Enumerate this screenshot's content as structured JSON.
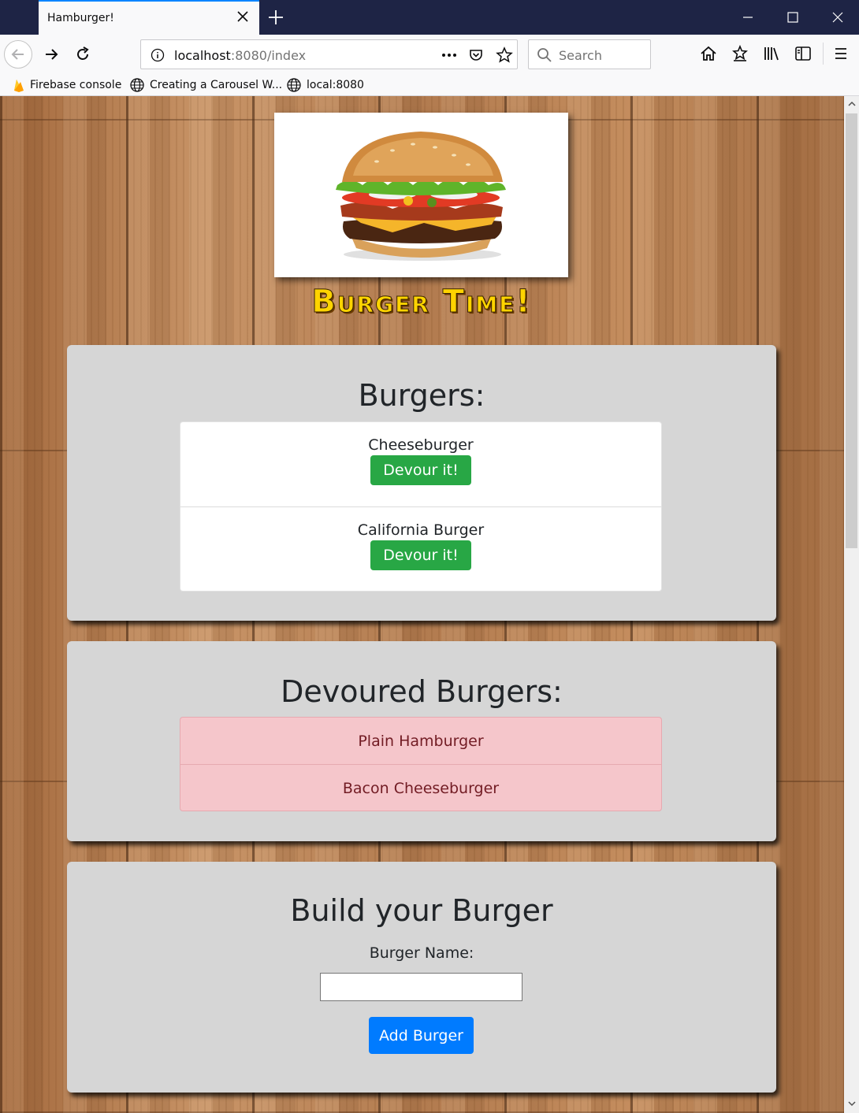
{
  "browser": {
    "tab_title": "Hamburger!",
    "url_host": "localhost",
    "url_rest": ":8080/index",
    "search_placeholder": "Search",
    "bookmarks": [
      "Firebase console",
      "Creating a Carousel W...",
      "local:8080"
    ]
  },
  "page": {
    "brand": "Burger Time!",
    "burgers_heading": "Burgers:",
    "burgers": [
      {
        "name": "Cheeseburger",
        "button": "Devour it!"
      },
      {
        "name": "California Burger",
        "button": "Devour it!"
      }
    ],
    "devoured_heading": "Devoured Burgers:",
    "devoured": [
      "Plain Hamburger",
      "Bacon Cheeseburger"
    ],
    "build_heading": "Build your Burger",
    "name_label": "Burger Name:",
    "name_value": "",
    "add_button": "Add Burger"
  },
  "colors": {
    "devour_button": "#28a745",
    "add_button": "#007bff",
    "devoured_bg": "#f5c6cb",
    "brand_title": "#ffd400"
  }
}
